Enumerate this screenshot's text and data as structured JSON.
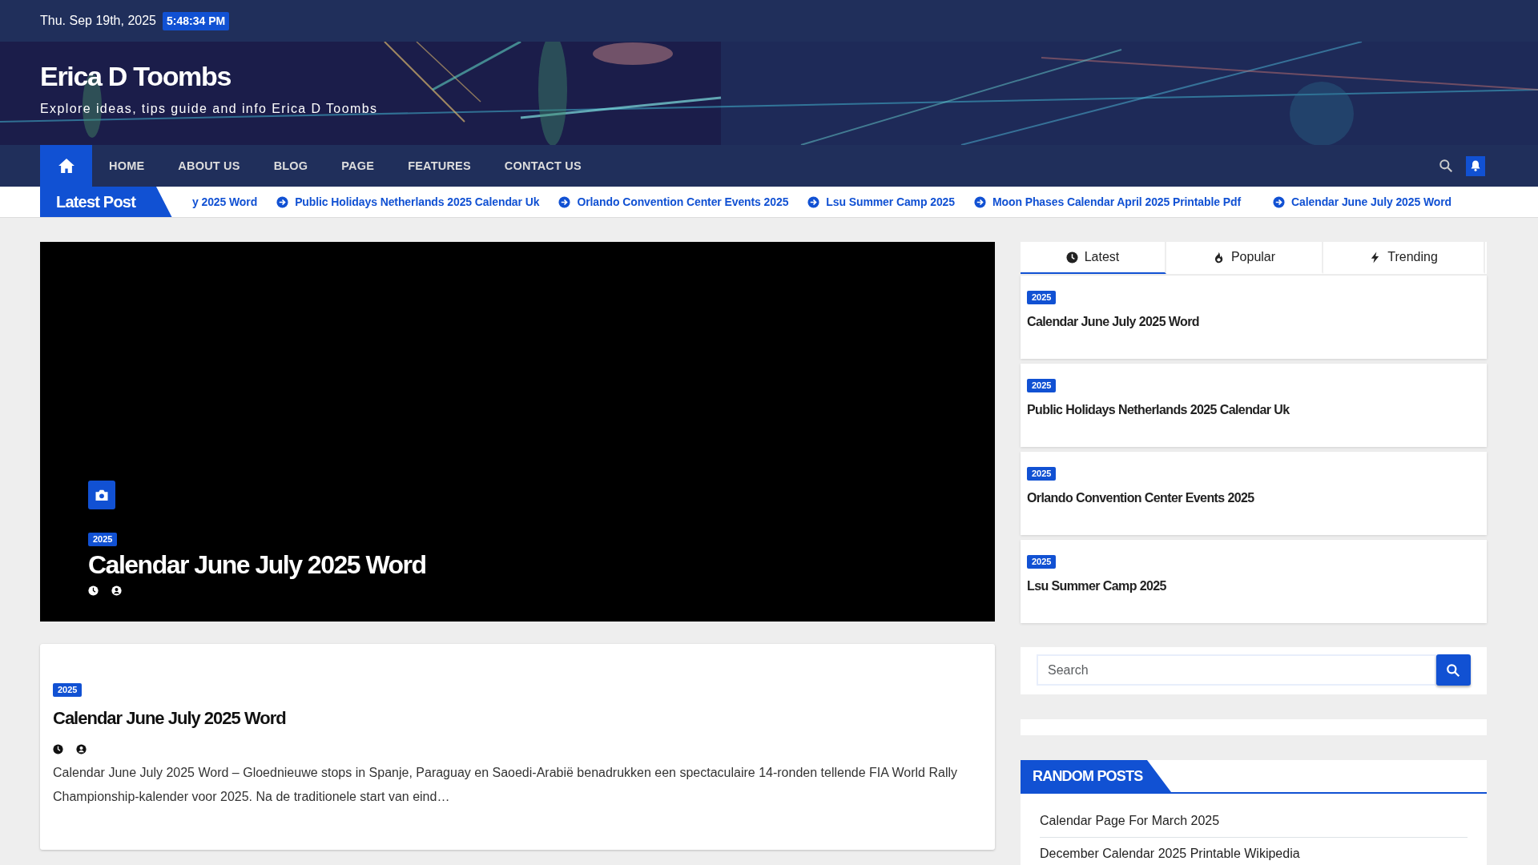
{
  "top_bar": {
    "date": "Thu. Sep 19th, 2025",
    "time": "5:48:34 PM"
  },
  "header": {
    "title": "Erica D Toombs",
    "tagline": "Explore ideas, tips guide and info Erica D Toombs"
  },
  "nav": {
    "home": {
      "selected": true
    },
    "items": [
      {
        "label": "HOME",
        "selected": false
      },
      {
        "label": "ABOUT US",
        "selected": false
      },
      {
        "label": "BLOG",
        "selected": false
      },
      {
        "label": "PAGE",
        "selected": false
      },
      {
        "label": "FEATURES",
        "selected": false
      },
      {
        "label": "CONTACT US",
        "selected": false
      }
    ]
  },
  "ticker": {
    "label": "Latest Post",
    "items": [
      {
        "text": "y 2025 Word",
        "icon": false
      },
      {
        "text": "Public Holidays Netherlands 2025 Calendar Uk",
        "icon": true
      },
      {
        "text": "Orlando Convention Center Events 2025",
        "icon": true
      },
      {
        "text": "Lsu Summer Camp 2025",
        "icon": true
      },
      {
        "text": "Moon Phases Calendar April 2025 Printable Pdf",
        "icon": true
      },
      {
        "text": "Calendar June July 2025 Word",
        "icon": true
      }
    ]
  },
  "hero": {
    "category": "2025",
    "title": "Calendar June July 2025 Word"
  },
  "post": {
    "category": "2025",
    "title": "Calendar June July 2025 Word",
    "excerpt": "Calendar June July 2025 Word – Gloednieuwe stops in Spanje, Paraguay en Saoedi-Arabië benadrukken een spectaculaire 14-ronden tellende FIA World Rally Championship-kalender voor 2025. Na de traditionele start van eind…"
  },
  "sidebar": {
    "tabs": [
      {
        "label": "Latest",
        "selected": true
      },
      {
        "label": "Popular",
        "selected": false
      },
      {
        "label": "Trending",
        "selected": false
      }
    ],
    "posts": [
      {
        "category": "2025",
        "title": "Calendar June July 2025 Word"
      },
      {
        "category": "2025",
        "title": "Public Holidays Netherlands 2025 Calendar Uk"
      },
      {
        "category": "2025",
        "title": "Orlando Convention Center Events 2025"
      },
      {
        "category": "2025",
        "title": "Lsu Summer Camp 2025"
      }
    ],
    "search": {
      "placeholder": "Search"
    },
    "random_posts": {
      "title": "RANDOM POSTS",
      "items": [
        {
          "text": "Calendar Page For March 2025"
        },
        {
          "text": "December Calendar 2025 Printable Wikipedia"
        }
      ]
    }
  }
}
